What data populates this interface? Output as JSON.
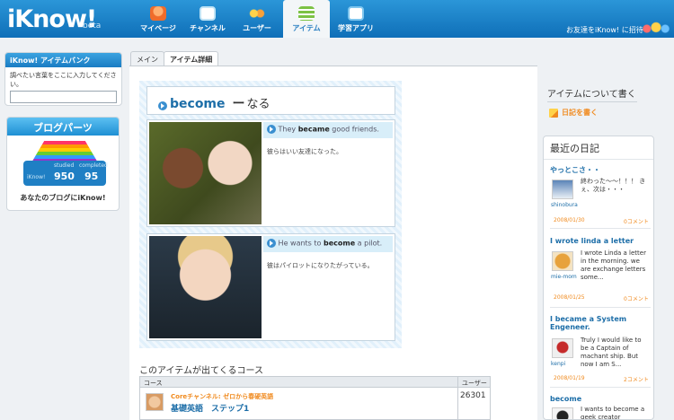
{
  "header": {
    "logo": "iKnow!",
    "logo_badge": "beta",
    "invite_text": "お友達をiKnow! に招待",
    "nav": [
      {
        "label": "マイページ",
        "icon": "mypage-icon"
      },
      {
        "label": "チャンネル",
        "icon": "tv-icon"
      },
      {
        "label": "ユーザー",
        "icon": "users-icon"
      },
      {
        "label": "アイテム",
        "icon": "items-icon",
        "active": true
      },
      {
        "label": "学習アプリ",
        "icon": "app-icon"
      }
    ]
  },
  "sidebar": {
    "itembank_title": "iKnow! アイテムバンク",
    "itembank_label": "調べたい言葉をここに入力してください。",
    "itembank_input_value": "",
    "blog_title": "ブログパーツ",
    "blog_stats": {
      "studied_label": "studied",
      "studied_value": "950",
      "completed_label": "completed",
      "completed_value": "95",
      "brand": "iKnow!"
    },
    "blog_caption": "あなたのブログにiKnow!"
  },
  "tabs": [
    {
      "label": "メイン"
    },
    {
      "label": "アイテム詳細",
      "active": true
    }
  ],
  "item": {
    "word": "become",
    "dash": "ー",
    "meaning": "なる",
    "examples": [
      {
        "pre": "They ",
        "bold": "became",
        "post": " good friends.",
        "ja": "彼らはいい友達になった。"
      },
      {
        "pre": "He wants to ",
        "bold": "become",
        "post": " a pilot.",
        "ja": "彼はパイロットになりたがっている。"
      }
    ]
  },
  "courses": {
    "heading": "このアイテムが出てくるコース",
    "col_course": "コース",
    "col_users": "ユーザー",
    "rows": [
      {
        "channel": "Coreチャンネル: ゼロから春硬英語",
        "name": "基礎英語　ステップ1",
        "users": "26301"
      }
    ]
  },
  "right": {
    "about_title": "アイテムについて書く",
    "write_diary": "日記を書く",
    "recent_title": "最近の日記",
    "entries": [
      {
        "title": "やっとこさ・・",
        "text": "終わった〜〜！！！ きぇ、次は・・・",
        "user": "shinobura",
        "date": "2008/01/30",
        "comments": "0コメント"
      },
      {
        "title": "I wrote linda a letter",
        "text": "I wrote Linda a letter in the morning. we are exchange letters some...",
        "user": "mie-mom",
        "date": "2008/01/25",
        "comments": "0コメント"
      },
      {
        "title": "I became a System Engeneer.",
        "text": "Truly I would like to be a Captain of machant ship. But now I am S...",
        "user": "kenpi",
        "date": "2008/01/19",
        "comments": "2コメント"
      },
      {
        "title": "become",
        "text": "I wants to become a geek creator",
        "user": "",
        "date": "",
        "comments": ""
      }
    ]
  }
}
